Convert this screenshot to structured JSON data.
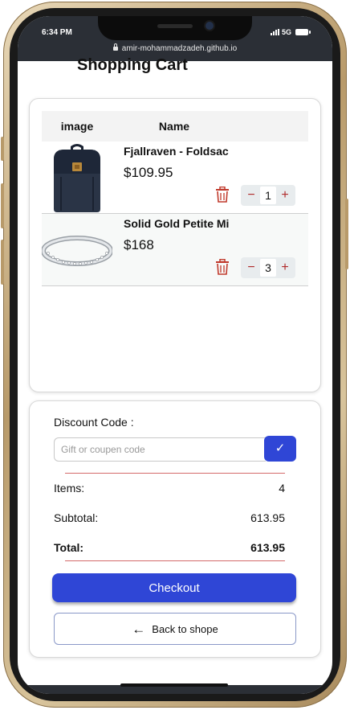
{
  "status_bar": {
    "time": "6:34 PM",
    "network": "5G",
    "url": "amir-mohammadzadeh.github.io"
  },
  "page": {
    "title": "Shopping Cart"
  },
  "cart_table": {
    "columns": [
      "image",
      "Name"
    ],
    "rows": [
      {
        "name": "Fjallraven - Foldsac",
        "price": "$109.95",
        "quantity": "1",
        "image": "backpack-image"
      },
      {
        "name": "Solid Gold Petite Mi",
        "price": "$168",
        "quantity": "3",
        "image": "bracelet-image"
      }
    ]
  },
  "summary": {
    "discount_label": "Discount Code :",
    "discount_placeholder": "Gift or coupen code",
    "apply_icon": "✓",
    "items_label": "Items:",
    "items_value": "4",
    "subtotal_label": "Subtotal:",
    "subtotal_value": "613.95",
    "total_label": "Total:",
    "total_value": "613.95",
    "checkout_label": "Checkout",
    "back_label": "Back to shope",
    "back_icon": "←"
  },
  "colors": {
    "primary": "#2f46d6",
    "danger": "#c0392b",
    "status_bar": "#2b2f36"
  }
}
